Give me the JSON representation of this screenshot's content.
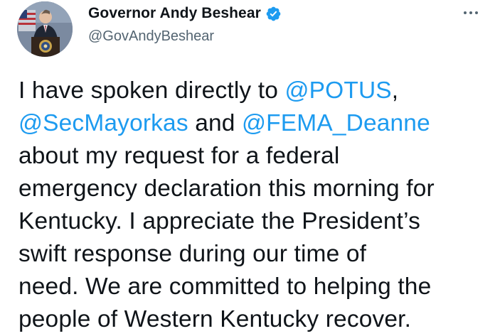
{
  "author": {
    "display_name": "Governor Andy Beshear",
    "handle": "@GovAndyBeshear",
    "verified": true
  },
  "menu": {
    "icon": "more-horizontal-icon"
  },
  "tweet": {
    "l1_a": "I have spoken directly to ",
    "l1_m": "@POTUS",
    "l1_b": ",",
    "l2_m1": "@SecMayorkas",
    "l2_a": " and ",
    "l2_m2": "@FEMA_Deanne",
    "l3": "about my request for a federal",
    "l4": "emergency declaration this morning for",
    "l5": "Kentucky. I appreciate the President’s",
    "l6": "swift response during our time of",
    "l7": "need. We are committed to helping the",
    "l8": "people of Western Kentucky recover."
  },
  "colors": {
    "link": "#1d9bf0",
    "text": "#0f1419",
    "secondary": "#536471",
    "verified_badge": "#1d9bf0"
  }
}
